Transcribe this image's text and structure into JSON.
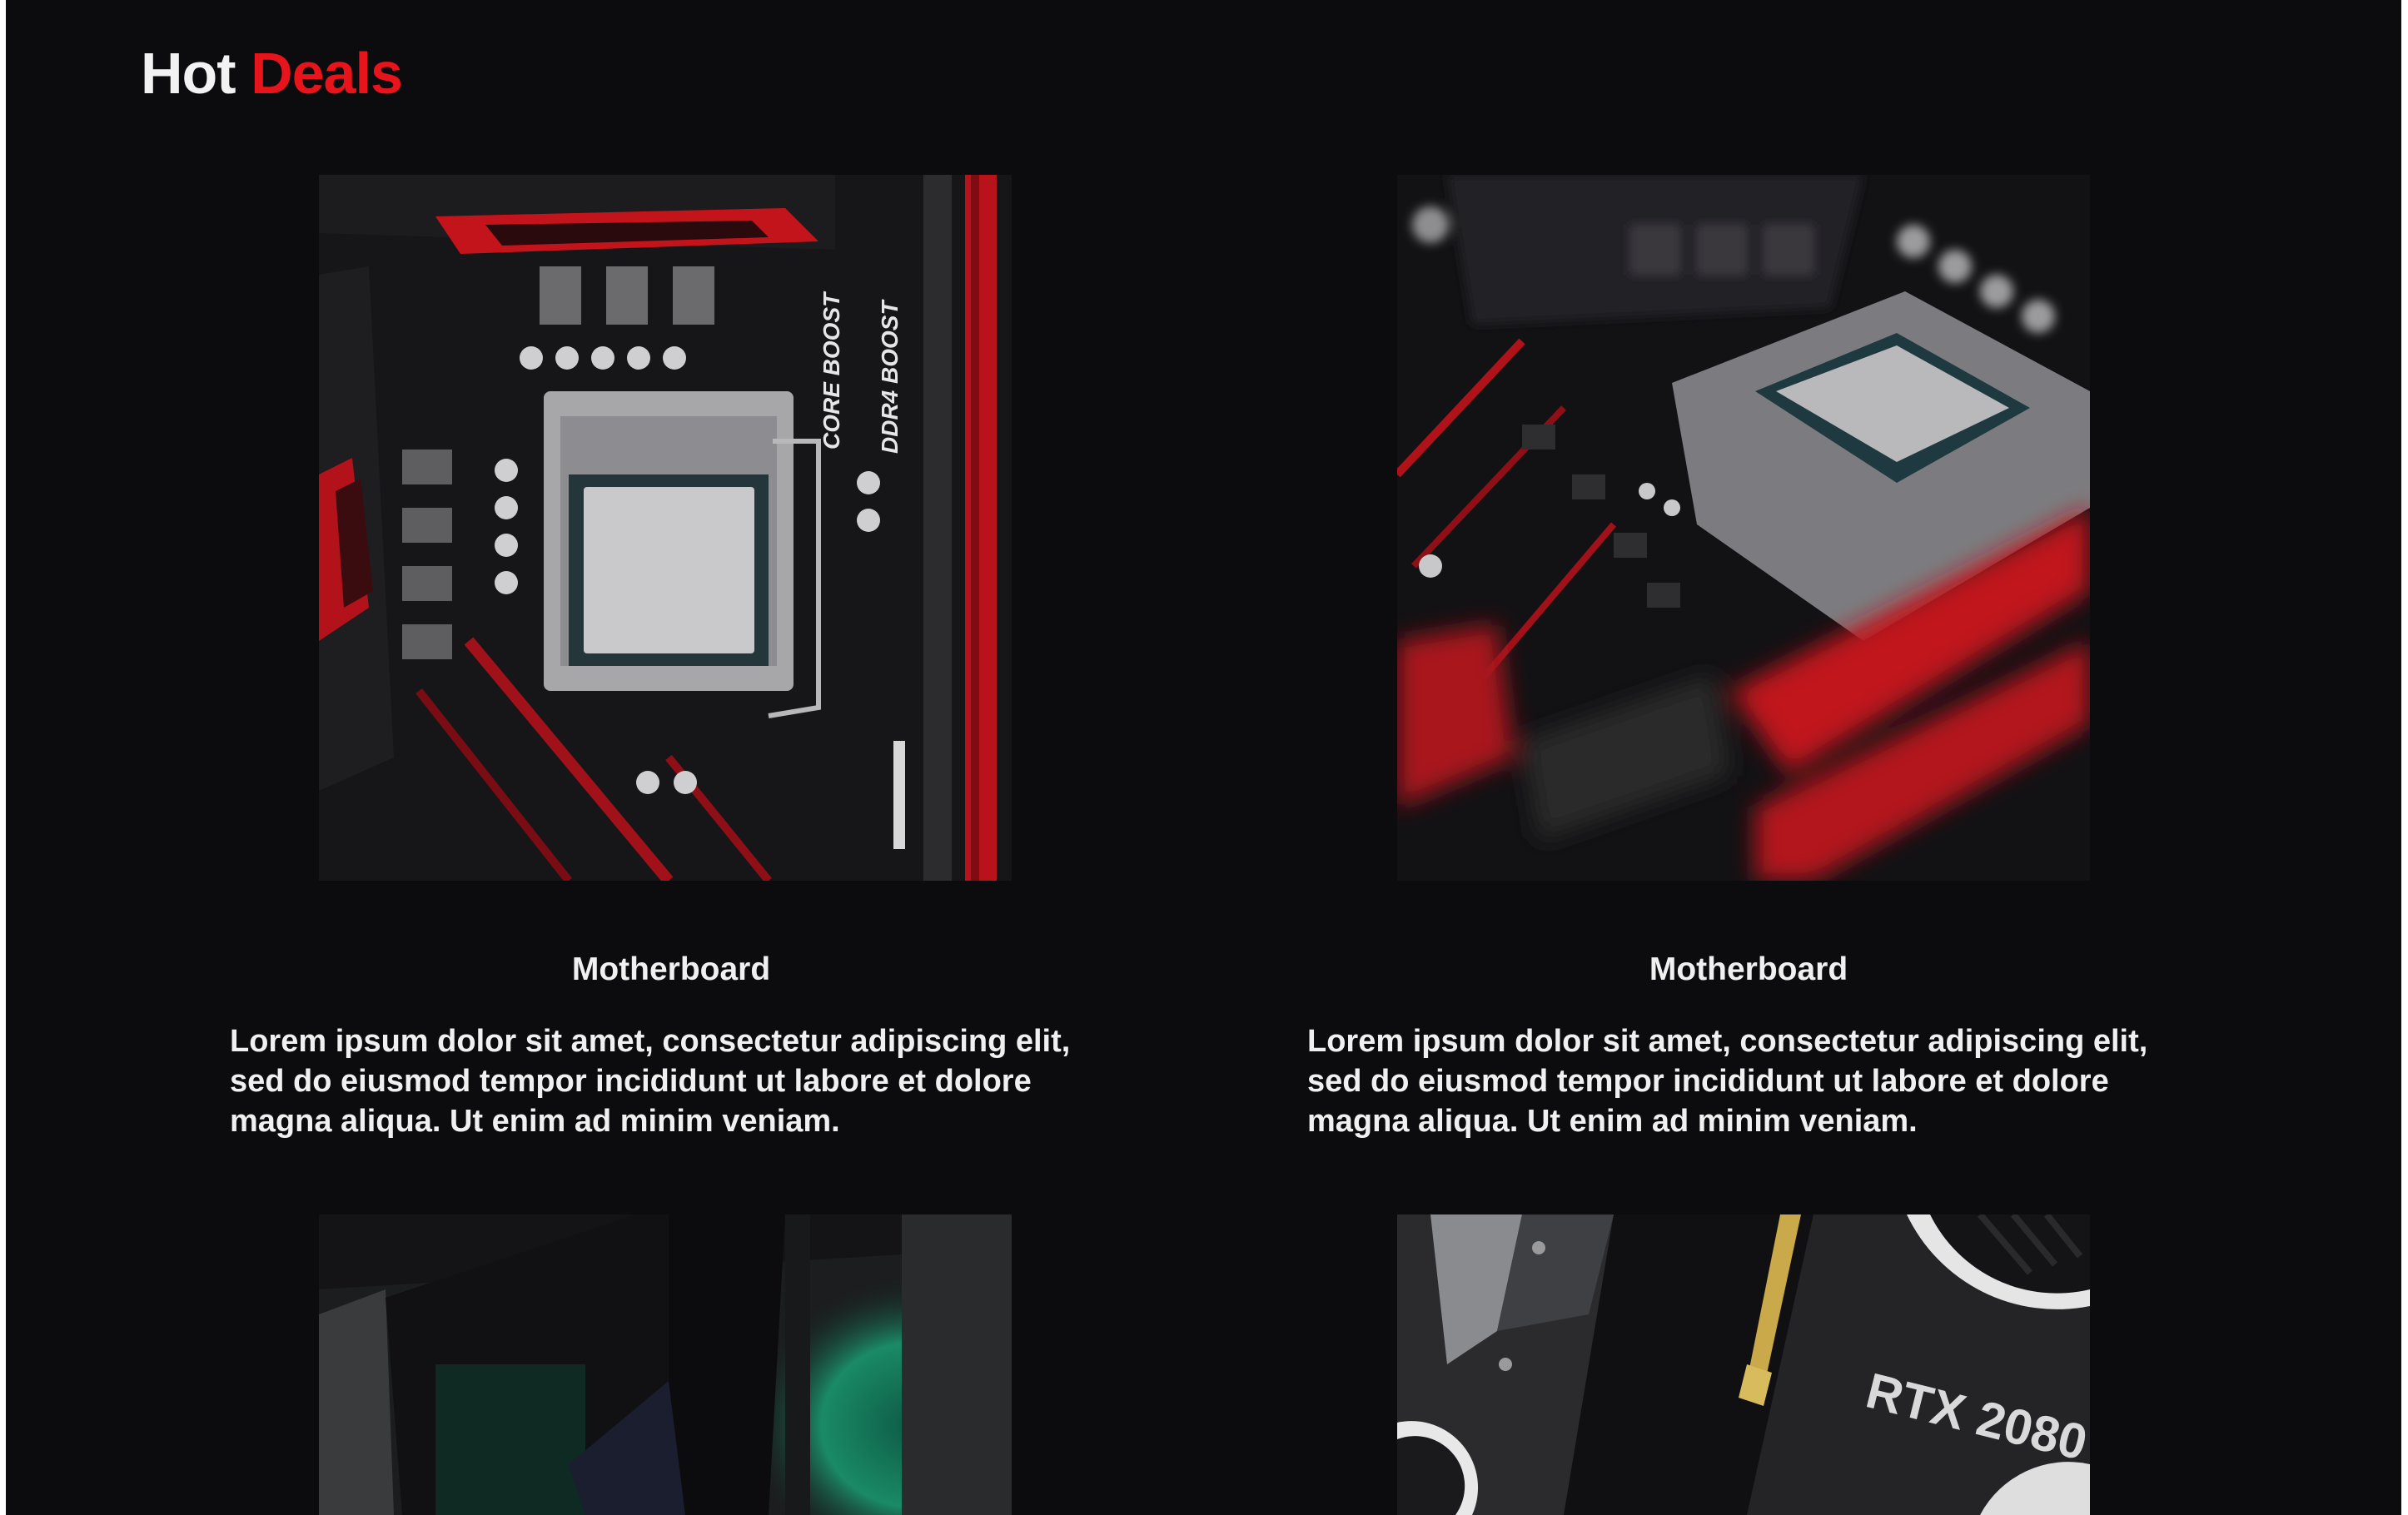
{
  "header": {
    "title_part1": "Hot",
    "title_part2": "Deals",
    "accent_color": "#e8141b"
  },
  "deals": [
    {
      "title": "Motherboard",
      "description": "Lorem ipsum dolor sit amet, consectetur adipiscing elit, sed do eiusmod tempor incididunt ut labore et dolore magna aliqua. Ut enim ad minim veniam.",
      "image": "motherboard-top-view",
      "image_text": [
        "CORE BOOST",
        "DDR4 BOOST"
      ]
    },
    {
      "title": "Motherboard",
      "description": "Lorem ipsum dolor sit amet, consectetur adipiscing elit, sed do eiusmod tempor incididunt ut labore et dolore magna aliqua. Ut enim ad minim veniam.",
      "image": "motherboard-angled-view"
    },
    {
      "image": "pc-case-green-fan"
    },
    {
      "image": "graphics-card",
      "image_text": [
        "RTX 2080"
      ]
    }
  ]
}
